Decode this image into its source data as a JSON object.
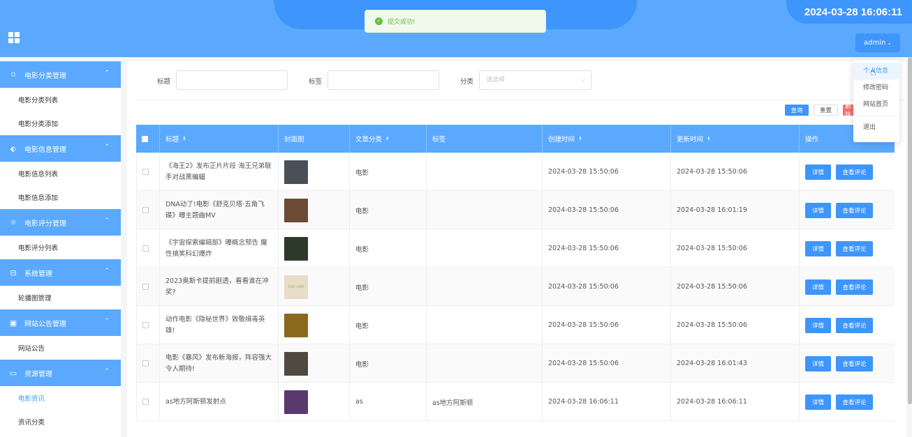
{
  "header": {
    "datetime": "2024-03-28 16:06:11",
    "user": "admin",
    "user_caret": "⌄"
  },
  "toast": {
    "message": "提交成功!",
    "icon": "✓"
  },
  "sidebar": {
    "groups": [
      {
        "title": "电影分类管理",
        "icon": "bookmark-icon",
        "items": [
          "电影分类列表",
          "电影分类添加"
        ]
      },
      {
        "title": "电影信息管理",
        "icon": "tag-icon",
        "items": [
          "电影信息列表",
          "电影信息添加"
        ]
      },
      {
        "title": "电影评分管理",
        "icon": "sun-icon",
        "items": [
          "电影评分列表"
        ]
      },
      {
        "title": "系统管理",
        "icon": "inbox-icon",
        "items": [
          "轮播图管理"
        ]
      },
      {
        "title": "网站公告管理",
        "icon": "clipboard-icon",
        "items": [
          "网站公告"
        ]
      },
      {
        "title": "资源管理",
        "icon": "chat-icon",
        "items": [
          "电影资讯",
          "资讯分类"
        ]
      }
    ],
    "active_item": "电影资讯"
  },
  "search": {
    "title_label": "标题",
    "tag_label": "标签",
    "category_label": "分类",
    "category_placeholder": "请选择",
    "query_button": "查询",
    "reset_button": "重置",
    "delete_button": "删除"
  },
  "table": {
    "headers": [
      "标题",
      "封面图",
      "文章分类",
      "标签",
      "创建时间",
      "更新时间",
      "操作"
    ],
    "detail_label": "详情",
    "comment_label": "查看评论",
    "rows": [
      {
        "title": "《海王2》发布正片片段 海王兄弟联手对战黑蝙蝠",
        "category": "电影",
        "tag": "",
        "created": "2024-03-28 15:50:06",
        "updated": "2024-03-28 15:50:06",
        "cover_color": "#4a5058"
      },
      {
        "title": "DNA动了!电影《舒克贝塔·五角飞碟》曝主题曲MV",
        "category": "电影",
        "tag": "",
        "created": "2024-03-28 15:50:06",
        "updated": "2024-03-28 16:01:19",
        "cover_color": "#6b4a36"
      },
      {
        "title": "《宇宙探索编辑部》曝概念预告 魔性搞笑科幻爆炸",
        "category": "电影",
        "tag": "",
        "created": "2024-03-28 15:50:06",
        "updated": "2024-03-28 15:50:06",
        "cover_color": "#2d3a2a"
      },
      {
        "title": "2023奥斯卡提前剧透，看看谁在冲奖?",
        "category": "电影",
        "tag": "",
        "created": "2024-03-28 15:50:06",
        "updated": "2024-03-28 15:50:06",
        "cover_color": "#e8ddc8",
        "cover_text": "OSCARS"
      },
      {
        "title": "动作电影《隐秘世界》致敬缉毒英雄!",
        "category": "电影",
        "tag": "",
        "created": "2024-03-28 15:50:06",
        "updated": "2024-03-28 15:50:06",
        "cover_color": "#8a6a1e"
      },
      {
        "title": "电影《暴风》发布新海报，阵容强大令人期待!",
        "category": "电影",
        "tag": "",
        "created": "2024-03-28 15:50:06",
        "updated": "2024-03-28 16:01:43",
        "cover_color": "#4e4a40"
      },
      {
        "title": "as地方阿斯顿发射点",
        "category": "as",
        "tag": "as地方阿斯顿",
        "created": "2024-03-28 16:06:11",
        "updated": "2024-03-28 16:06:11",
        "cover_color": "#5a3a6e"
      }
    ]
  },
  "dropdown": {
    "items": [
      "个人信息",
      "修改密码",
      "网站首页",
      "退出"
    ]
  }
}
